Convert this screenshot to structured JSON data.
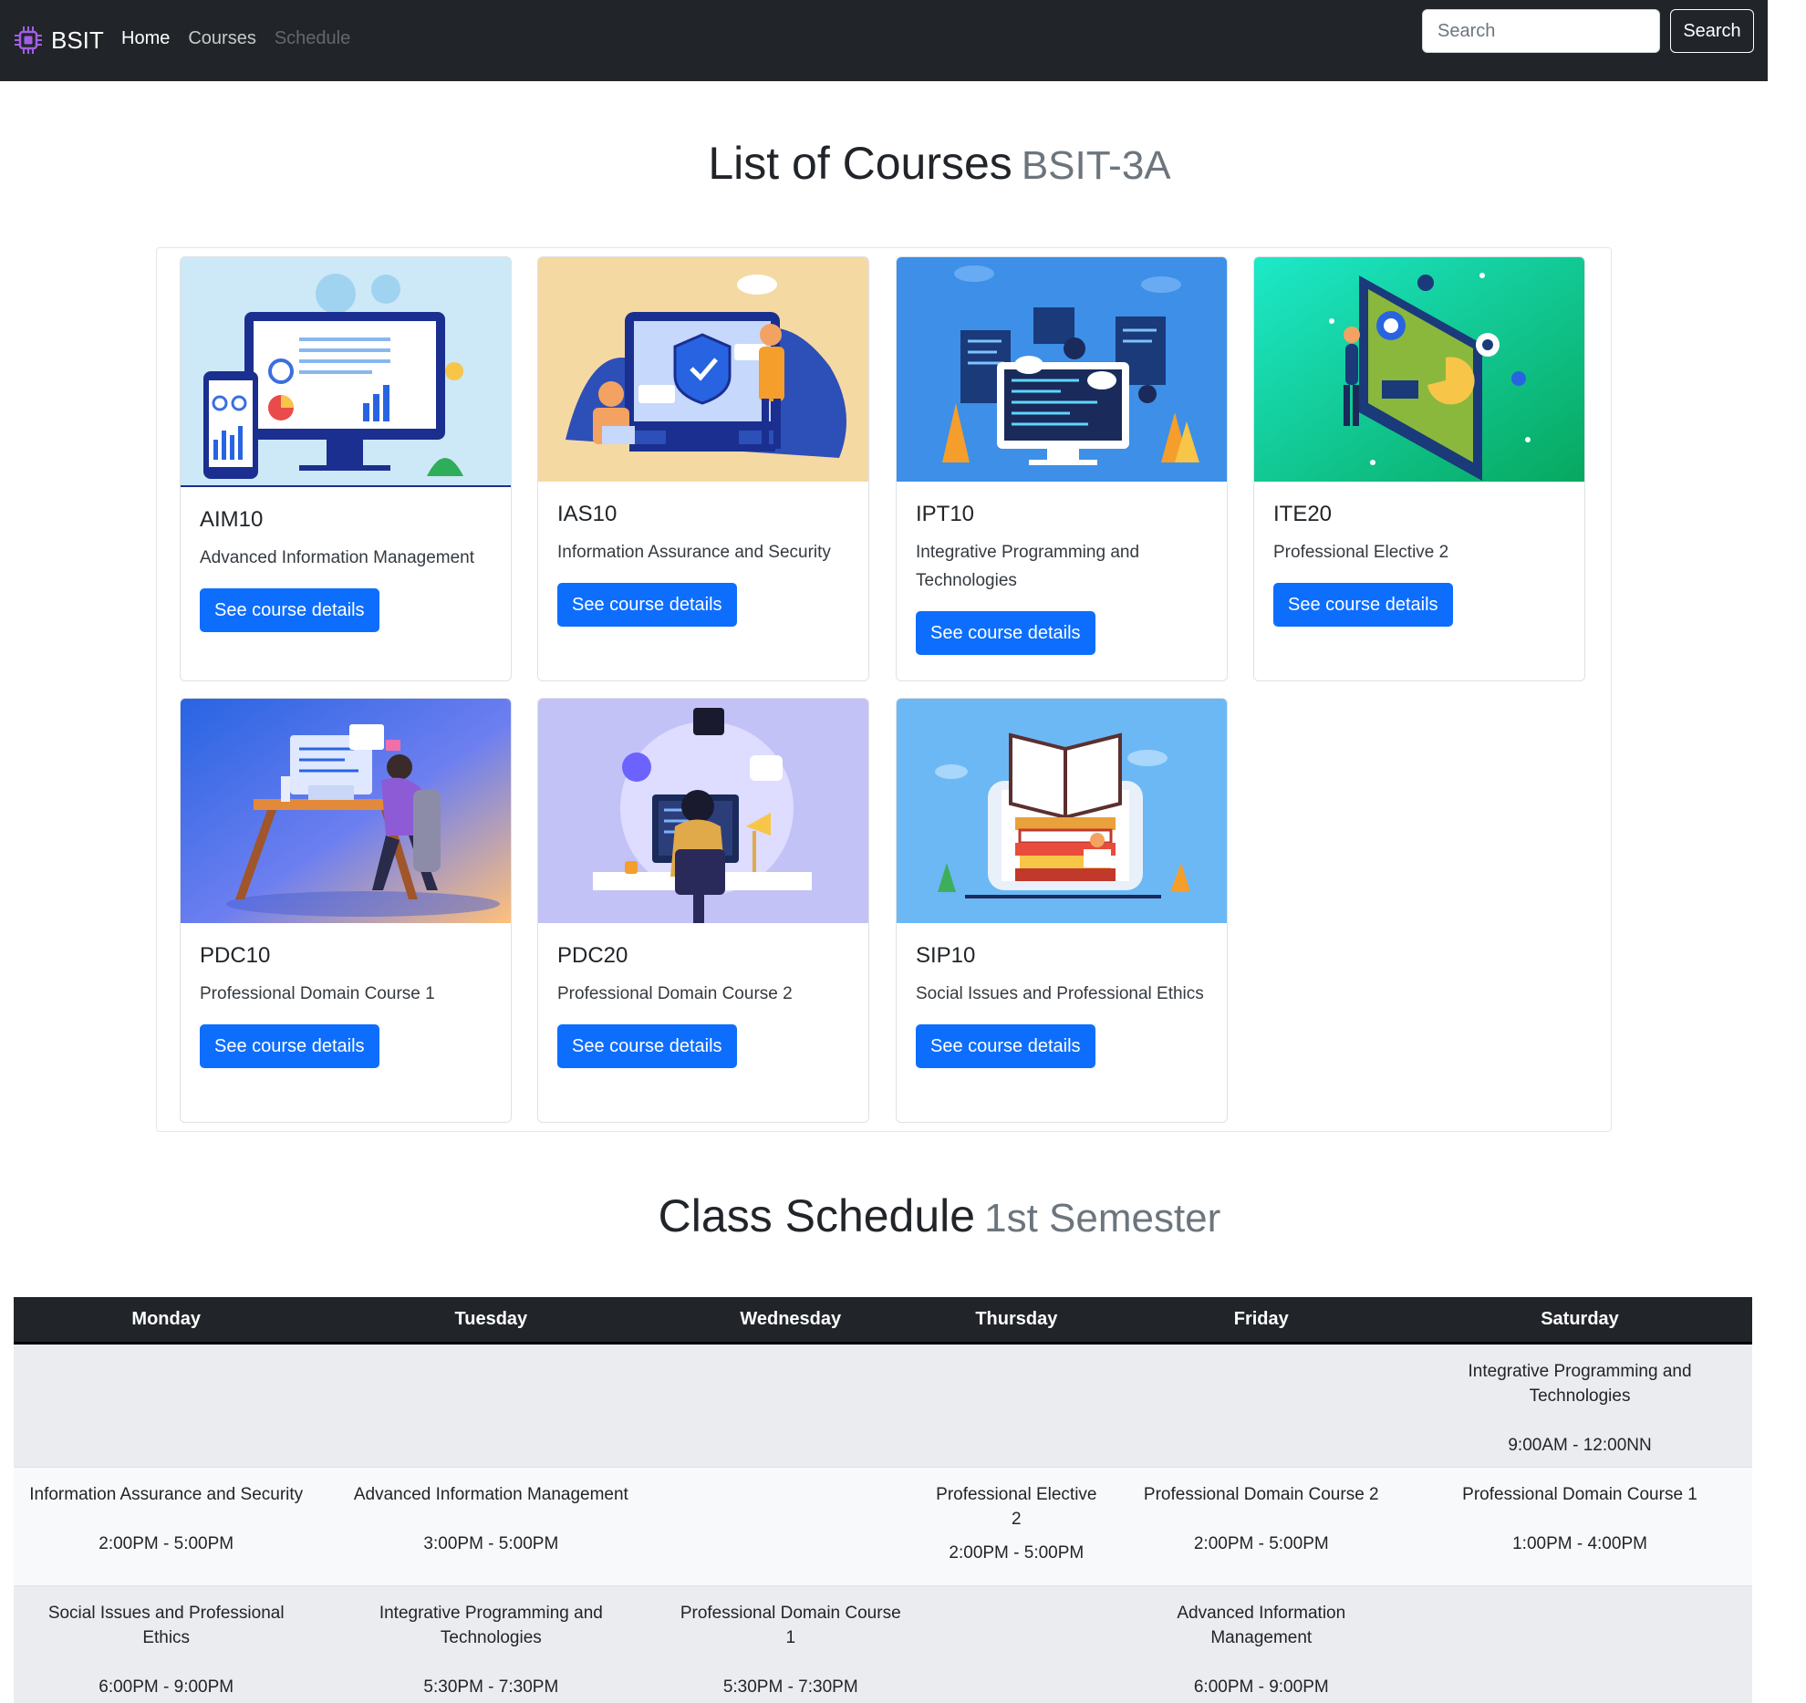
{
  "navbar": {
    "brand": "BSIT",
    "links": [
      {
        "label": "Home",
        "state": "active"
      },
      {
        "label": "Courses",
        "state": "normal"
      },
      {
        "label": "Schedule",
        "state": "disabled"
      }
    ],
    "search_placeholder": "Search",
    "search_button": "Search"
  },
  "courses_section": {
    "title": "List of Courses",
    "subtitle": "BSIT-3A",
    "button_label": "See course details",
    "courses": [
      {
        "code": "AIM10",
        "title": "Advanced Information Management",
        "illustration": "data-dashboard-illustration"
      },
      {
        "code": "IAS10",
        "title": "Information Assurance and Security",
        "illustration": "security-shield-illustration"
      },
      {
        "code": "IPT10",
        "title": "Integrative Programming and Technologies",
        "illustration": "programming-monitor-illustration"
      },
      {
        "code": "ITE20",
        "title": "Professional Elective 2",
        "illustration": "interactive-screen-illustration"
      },
      {
        "code": "PDC10",
        "title": "Professional Domain Course 1",
        "illustration": "developer-desk-illustration"
      },
      {
        "code": "PDC20",
        "title": "Professional Domain Course 2",
        "illustration": "coder-languages-illustration"
      },
      {
        "code": "SIP10",
        "title": "Social Issues and Professional Ethics",
        "illustration": "books-tablet-illustration"
      }
    ]
  },
  "schedule_section": {
    "title": "Class Schedule",
    "subtitle": "1st Semester",
    "days": [
      "Monday",
      "Tuesday",
      "Wednesday",
      "Thursday",
      "Friday",
      "Saturday"
    ],
    "rows": [
      [
        {
          "subject": "",
          "time": ""
        },
        {
          "subject": "",
          "time": ""
        },
        {
          "subject": "",
          "time": ""
        },
        {
          "subject": "",
          "time": ""
        },
        {
          "subject": "",
          "time": ""
        },
        {
          "subject": "Integrative Programming and Technologies",
          "time": "9:00AM - 12:00NN"
        }
      ],
      [
        {
          "subject": "Information Assurance and Security",
          "time": "2:00PM - 5:00PM"
        },
        {
          "subject": "Advanced Information Management",
          "time": "3:00PM - 5:00PM"
        },
        {
          "subject": "",
          "time": ""
        },
        {
          "subject": "Professional Elective 2",
          "time": "2:00PM - 5:00PM"
        },
        {
          "subject": "Professional Domain Course 2",
          "time": "2:00PM - 5:00PM"
        },
        {
          "subject": "Professional Domain Course 1",
          "time": "1:00PM - 4:00PM"
        }
      ],
      [
        {
          "subject": "Social Issues and Professional Ethics",
          "time": "6:00PM - 9:00PM"
        },
        {
          "subject": "Integrative Programming and Technologies",
          "time": "5:30PM - 7:30PM"
        },
        {
          "subject": "Professional Domain Course 1",
          "time": "5:30PM - 7:30PM"
        },
        {
          "subject": "",
          "time": ""
        },
        {
          "subject": "Advanced Information Management",
          "time": "6:00PM - 9:00PM"
        },
        {
          "subject": "",
          "time": ""
        }
      ]
    ]
  },
  "colors": {
    "navbar_bg": "#212529",
    "primary_button": "#0d6efd",
    "muted_text": "#6c757d",
    "brand_icon": "#a45ee5"
  }
}
